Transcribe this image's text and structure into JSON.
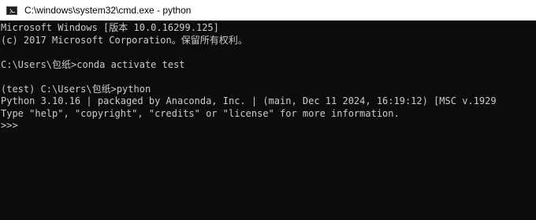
{
  "window": {
    "title": "C:\\windows\\system32\\cmd.exe - python",
    "icon": "terminal-icon"
  },
  "console": {
    "lines": [
      "Microsoft Windows [版本 10.0.16299.125]",
      "(c) 2017 Microsoft Corporation。保留所有权利。",
      "",
      "C:\\Users\\包纸>conda activate test",
      "",
      "(test) C:\\Users\\包纸>python",
      "Python 3.10.16 | packaged by Anaconda, Inc. | (main, Dec 11 2024, 16:19:12) [MSC v.1929",
      "Type \"help\", \"copyright\", \"credits\" or \"license\" for more information.",
      ">>>"
    ]
  }
}
